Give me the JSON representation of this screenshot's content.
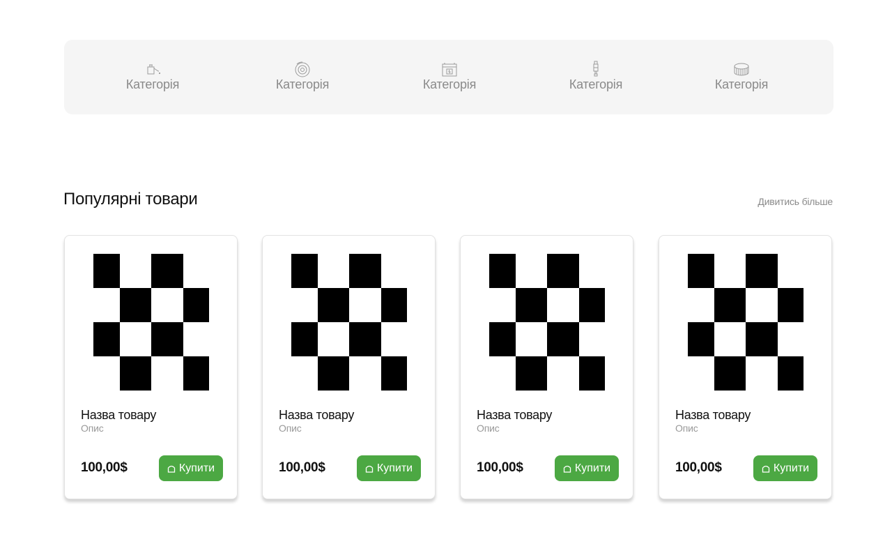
{
  "categories": [
    {
      "label": "Категорія",
      "icon": "oil-can-icon"
    },
    {
      "label": "Категорія",
      "icon": "brake-disc-icon"
    },
    {
      "label": "Категорія",
      "icon": "battery-icon"
    },
    {
      "label": "Категорія",
      "icon": "spark-plug-icon"
    },
    {
      "label": "Категорія",
      "icon": "air-filter-icon"
    }
  ],
  "popular": {
    "title": "Популярні товари",
    "see_more": "Дивитись більше"
  },
  "products": [
    {
      "name": "Назва товару",
      "description": "Опис",
      "price": "100,00$",
      "buy_label": "Купити"
    },
    {
      "name": "Назва товару",
      "description": "Опис",
      "price": "100,00$",
      "buy_label": "Купити"
    },
    {
      "name": "Назва товару",
      "description": "Опис",
      "price": "100,00$",
      "buy_label": "Купити"
    },
    {
      "name": "Назва товару",
      "description": "Опис",
      "price": "100,00$",
      "buy_label": "Купити"
    }
  ],
  "colors": {
    "accent": "#4ca843",
    "category_bar_bg": "#f5f5f5",
    "muted_text": "#8a8a8a"
  }
}
